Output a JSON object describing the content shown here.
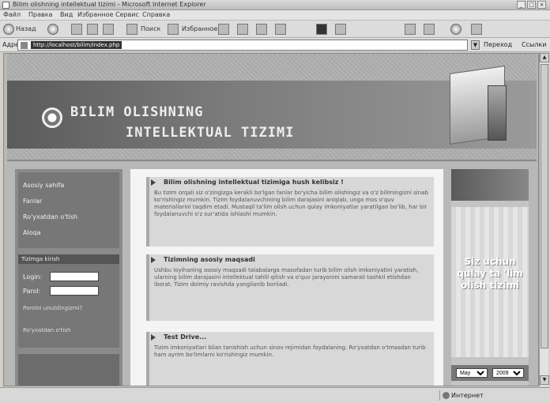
{
  "window": {
    "title": "Bilim olishning intellektual tizimi - Microsoft Internet Explorer"
  },
  "menu": [
    "Файл",
    "Правка",
    "Вид",
    "Избранное",
    "Сервис",
    "Справка"
  ],
  "toolbar": {
    "back": "Назад",
    "search": "Поиск",
    "favorites": "Избранное"
  },
  "address": {
    "label": "Адрес",
    "url": "http://localhost/bilim/index.php",
    "go": "Переход",
    "links": "Ссылки"
  },
  "header": {
    "line1": "BILIM OLISHNING",
    "line2": "INTELLEKTUAL TIZIMI"
  },
  "sidebar": {
    "items": [
      "Asosiy sahifa",
      "Fanlar",
      "Ro'yxatdan o'tish",
      "Aloqa"
    ],
    "login_title": "Tizimga kirish",
    "login_label": "Login:",
    "password_label": "Parol:",
    "forgot": "Parolni unutdingizmi?",
    "register": "Ro'yxatdan o'tish"
  },
  "main": {
    "sections": [
      {
        "title": "Bilim olishning intellektual tizimiga hush kelibsiz !",
        "text": "Bu tizim orqali siz o'zingizga kerakli bo'lgan fanlar bo'yicha bilim olishingiz va o'z bilimingizni sinab ko'rishingiz mumkin. Tizim foydalanuvchining bilim darajasini aniqlab, unga mos o'quv materiallarini taqdim etadi. Mustaqil ta'lim olish uchun qulay imkoniyatlar yaratilgan bo'lib, har bir foydalanuvchi o'z sur'atida ishlashi mumkin."
      },
      {
        "title": "Tizimning asosiy maqsadi",
        "text": "Ushbu loyihaning asosiy maqsadi talabalarga masofadan turib bilim olish imkoniyatini yaratish, ularning bilim darajasini intellektual tahlil qilish va o'quv jarayonini samarali tashkil etishdan iborat. Tizim doimiy ravishda yangilanib boriladi."
      },
      {
        "title": "Test Drive...",
        "text": "Tizim imkoniyatlari bilan tanishish uchun sinov rejimidan foydalaning. Ro'yxatdan o'tmasdan turib ham ayrim bo'limlarni ko'rishingiz mumkin."
      }
    ]
  },
  "right": {
    "ad_text": "Siz uchun qulay ta 'lim olish tizimi",
    "month": "May",
    "year": "2009"
  },
  "status": {
    "left": "",
    "zone": "Интернет"
  }
}
